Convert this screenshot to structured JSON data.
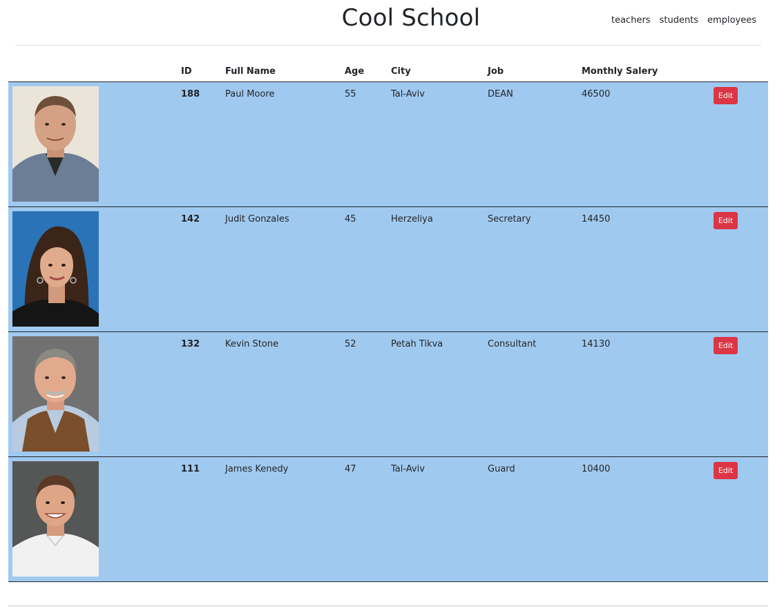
{
  "header": {
    "title": "Cool School",
    "nav": [
      "teachers",
      "students",
      "employees"
    ]
  },
  "table": {
    "columns": [
      "ID",
      "Full Name",
      "Age",
      "City",
      "Job",
      "Monthly Salery"
    ],
    "edit_label": "Edit",
    "rows": [
      {
        "id": "188",
        "name": "Paul Moore",
        "age": "55",
        "city": "Tal-Aviv",
        "job": "DEAN",
        "salary": "46500",
        "photo_icon": "man-portrait-bald-icon"
      },
      {
        "id": "142",
        "name": "Judit Gonzales",
        "age": "45",
        "city": "Herzeliya",
        "job": "Secretary",
        "salary": "14450",
        "photo_icon": "woman-portrait-icon"
      },
      {
        "id": "132",
        "name": "Kevin Stone",
        "age": "52",
        "city": "Petah Tikva",
        "job": "Consultant",
        "salary": "14130",
        "photo_icon": "man-portrait-vest-icon"
      },
      {
        "id": "111",
        "name": "James Kenedy",
        "age": "47",
        "city": "Tal-Aviv",
        "job": "Guard",
        "salary": "10400",
        "photo_icon": "man-portrait-white-shirt-icon"
      }
    ]
  },
  "colors": {
    "row_background": "#a0c9ef",
    "edit_button": "#dc3545"
  }
}
